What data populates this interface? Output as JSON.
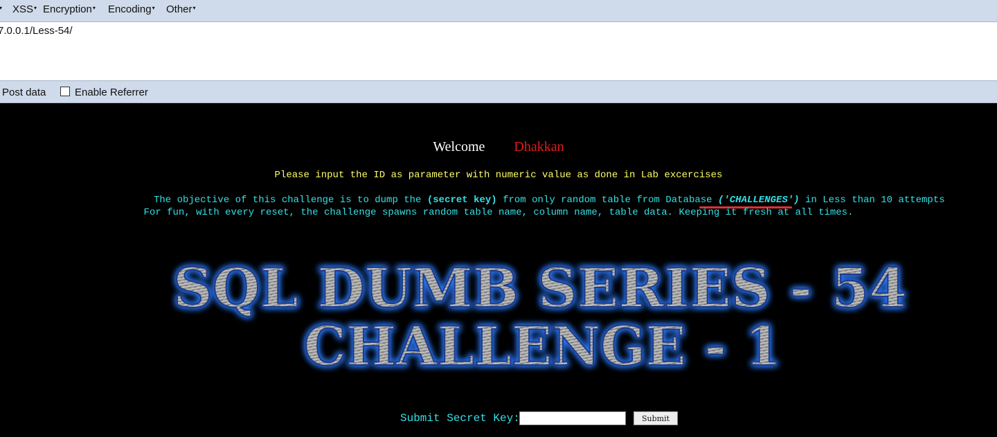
{
  "hackbar": {
    "menu": [
      {
        "label": "XSS"
      },
      {
        "label": "Encryption"
      },
      {
        "label": "Encoding"
      },
      {
        "label": "Other"
      }
    ],
    "caret": "▾",
    "url_value": "7.0.0.1/Less-54/",
    "options": {
      "post_data_label": "Post data",
      "enable_referrer_label": "Enable Referrer",
      "enable_referrer_checked": false
    }
  },
  "page": {
    "welcome": "Welcome",
    "user_name": "Dhakkan",
    "instruction": "Please input the ID as parameter with numeric value as done in Lab excercises",
    "objective_prefix": "The objective of this challenge is to dump the ",
    "objective_key": "(secret key)",
    "objective_mid": " from only random table from Database ",
    "objective_db": "('CHALLENGES')",
    "objective_suffix": " in Less than 10 attempts",
    "fun_line": "For fun, with every reset, the challenge spawns random table name, column name, table data. Keeping it fresh at all times.",
    "banner_line1": "SQL DUMB SERIES - 54",
    "banner_line2": "CHALLENGE - 1",
    "submit_label": "Submit Secret Key:",
    "key_value": "",
    "submit_button": "Submit"
  },
  "colors": {
    "toolbar_bg": "#cfdaea",
    "page_bg": "#000000",
    "welcome_name": "#e31b1b",
    "instruction": "#ffff66",
    "cyan_text": "#33e0e6",
    "annotation_underline": "#e03030",
    "banner_glow": "#2f7bff"
  }
}
